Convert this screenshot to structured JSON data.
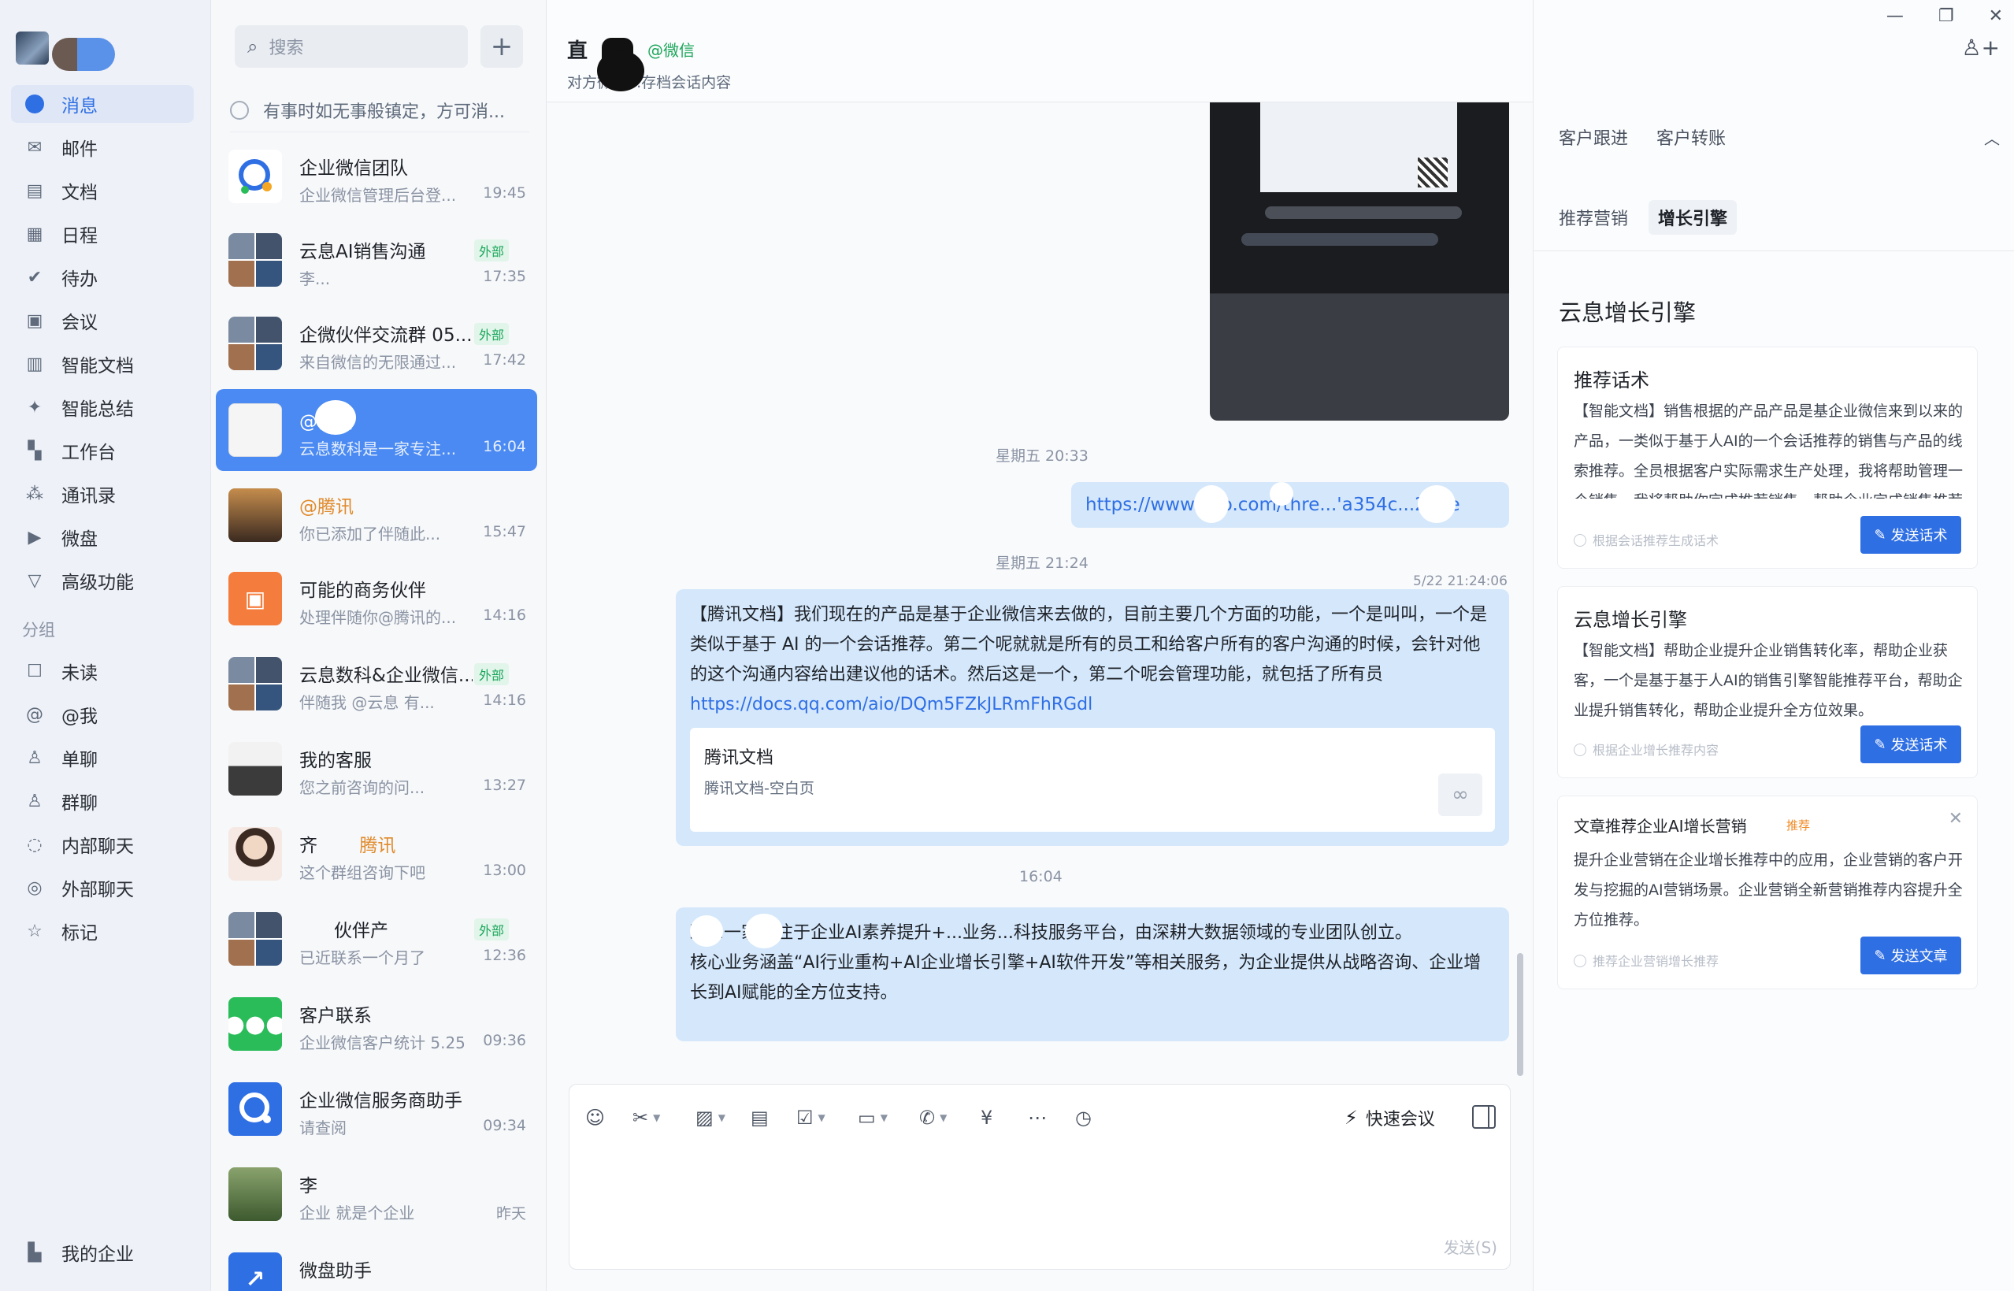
{
  "nav": {
    "items": [
      {
        "label": "消息",
        "icon": "message-icon",
        "active": true
      },
      {
        "label": "邮件",
        "icon": "mail-icon"
      },
      {
        "label": "文档",
        "icon": "doc-icon"
      },
      {
        "label": "日程",
        "icon": "calendar-icon"
      },
      {
        "label": "待办",
        "icon": "todo-icon"
      },
      {
        "label": "会议",
        "icon": "meeting-icon"
      },
      {
        "label": "智能文档",
        "icon": "smart-doc-icon"
      },
      {
        "label": "智能总结",
        "icon": "sparkle-icon"
      },
      {
        "label": "工作台",
        "icon": "workspace-icon"
      },
      {
        "label": "通讯录",
        "icon": "contacts-icon"
      },
      {
        "label": "微盘",
        "icon": "drive-icon"
      },
      {
        "label": "高级功能",
        "icon": "advanced-icon"
      }
    ],
    "group_label": "分组",
    "groups": [
      {
        "label": "未读",
        "icon": "unread-icon"
      },
      {
        "label": "@我",
        "icon": "at-icon"
      },
      {
        "label": "单聊",
        "icon": "single-chat-icon"
      },
      {
        "label": "群聊",
        "icon": "group-chat-icon"
      },
      {
        "label": "内部聊天",
        "icon": "internal-chat-icon"
      },
      {
        "label": "外部聊天",
        "icon": "external-chat-icon"
      },
      {
        "label": "标记",
        "icon": "star-icon"
      }
    ],
    "my_company": "我的企业"
  },
  "search": {
    "placeholder": "搜索"
  },
  "pinned_note": "有事时如无事般镇定，方可消...",
  "conversations": [
    {
      "name": "企业微信团队",
      "preview": "企业微信管理后台登...",
      "time": "19:45"
    },
    {
      "name": "云息AI销售沟通",
      "preview": "李...",
      "time": "17:35",
      "tag": "外部"
    },
    {
      "name": "企微伙伴交流群 05...",
      "preview": "来自微信的无限通过...",
      "time": "17:42",
      "tag": "外部"
    },
    {
      "name": "@微信",
      "preview": "云息数科是一家专注...",
      "time": "16:04"
    },
    {
      "name": "@腾讯",
      "preview": "你已添加了伴随此...",
      "time": "15:47"
    },
    {
      "name": "可能的商务伙伴",
      "preview": "处理伴随你@腾讯的...",
      "time": "14:16"
    },
    {
      "name": "云息数科&企业微信...",
      "preview": "伴随我 @云息 有...",
      "time": "14:16",
      "tag": "外部"
    },
    {
      "name": "我的客服",
      "preview": "您之前咨询的问...",
      "time": "13:27"
    },
    {
      "name": "齐",
      "name_tag": "腾讯",
      "preview": "这个群组咨询下吧",
      "time": "13:00"
    },
    {
      "name": "伙伴产",
      "preview": "已近联系一个月了",
      "time": "12:36",
      "tag": "外部"
    },
    {
      "name": "客户联系",
      "preview": "企业微信客户统计 5.25",
      "time": "09:36"
    },
    {
      "name": "企业微信服务商助手",
      "preview": "请查阅",
      "time": "09:34"
    },
    {
      "name": "李",
      "preview": "企业 就是个企业",
      "time": "昨天"
    },
    {
      "name": "微盘助手",
      "preview": "",
      "time": ""
    }
  ],
  "chat": {
    "title": "直",
    "title_tag": "@微信",
    "subtitle": "对方微信...存档会话内容",
    "time_fri_2033": "星期五 20:33",
    "link_url": "https://www...ao.com/thre...'a354c...2ade",
    "time_fri_2124": "星期五 21:24",
    "time_522": "5/22 21:24:06",
    "doc_message": "【腾讯文档】我们现在的产品是基于企业微信来去做的，目前主要几个方面的功能，一个是叫叫，一个是类似于基于 AI 的一个会话推荐。第二个呢就就是所有的员工和给客户所有的客户沟通的时候，会针对他的这个沟通内容给出建议他的话术。然后这是一个，第二个呢会管理功能，就包括了所有员",
    "doc_link": "https://docs.qq.com/aio/DQm5FZkJLRmFhRGdl",
    "doc_card_title": "腾讯文档",
    "doc_card_sub": "腾讯文档-空白页",
    "time_1604": "16:04",
    "intro_line1": "致...一家专注于企业AI素养提升+...业务...科技服务平台，由深耕大数据领域的专业团队创立。",
    "intro_line2": "核心业务涵盖“AI行业重构+AI企业增长引擎+AI软件开发”等相关服务，为企业提供从战略咨询、企业增长到AI赋能的全方位支持。",
    "quick_meeting": "快速会议",
    "send": "发送(S)"
  },
  "side": {
    "tabs": [
      "客户跟进",
      "客户转账"
    ],
    "subtabs": [
      "推荐营销",
      "增长引擎"
    ],
    "engine_title": "云息增长引擎",
    "cards": [
      {
        "title": "推荐话术",
        "body": "【智能文档】销售根据的产品产品是基企业微信来到以来的产品，一类似于基于人AI的一个会话推荐的销售与产品的线索推荐。全员根据客户实际需求生产处理，我将帮助管理一个销售，我将帮助你完成推荐销售，帮助企业完成销售推荐服务。",
        "footer": "根据会话推荐生成话术",
        "button": "发送话术"
      },
      {
        "title": "云息增长引擎",
        "body": "【智能文档】帮助企业提升企业销售转化率，帮助企业获客，一个是基于基于人AI的销售引擎智能推荐平台，帮助企业提升销售转化，帮助企业提升全方位效果。",
        "footer": "根据企业增长推荐内容",
        "button": "发送话术"
      },
      {
        "title": "文章推荐企业AI增长营销",
        "tag": "推荐",
        "body": "提升企业营销在企业增长推荐中的应用，企业营销的客户开发与挖掘的AI营销场景。企业营销全新营销推荐内容提升全方位推荐。",
        "footer": "推荐企业营销增长推荐",
        "button": "发送文章"
      }
    ]
  }
}
